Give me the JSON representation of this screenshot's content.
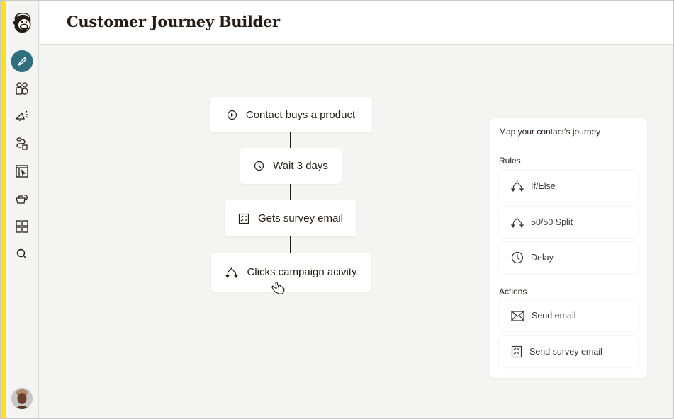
{
  "header": {
    "title": "Customer Journey Builder"
  },
  "sidebar": {
    "logo": "mailchimp-logo",
    "items": [
      {
        "name": "create",
        "icon": "pencil-icon",
        "active": true
      },
      {
        "name": "audience",
        "icon": "audience-icon"
      },
      {
        "name": "campaigns",
        "icon": "megaphone-icon"
      },
      {
        "name": "automations",
        "icon": "automation-icon"
      },
      {
        "name": "website",
        "icon": "website-icon"
      },
      {
        "name": "content",
        "icon": "content-icon"
      },
      {
        "name": "integrations",
        "icon": "grid-icon"
      },
      {
        "name": "search",
        "icon": "search-icon"
      }
    ],
    "avatar": "user-avatar"
  },
  "journey": {
    "nodes": [
      {
        "label": "Contact buys a product",
        "icon": "play-icon"
      },
      {
        "label": "Wait 3 days",
        "icon": "clock-icon"
      },
      {
        "label": "Gets survey email",
        "icon": "survey-icon"
      },
      {
        "label": "Clicks campaign acivity",
        "icon": "split-icon"
      }
    ]
  },
  "panel": {
    "title": "Map your contact’s journey",
    "rules_label": "Rules",
    "rules": [
      {
        "label": "If/Else",
        "icon": "split-icon"
      },
      {
        "label": "50/50 Split",
        "icon": "split-icon"
      },
      {
        "label": "Delay",
        "icon": "clock-icon"
      }
    ],
    "actions_label": "Actions",
    "actions": [
      {
        "label": "Send email",
        "icon": "envelope-icon"
      },
      {
        "label": "Send survey email",
        "icon": "survey-icon"
      }
    ]
  },
  "colors": {
    "accent": "#ffe01b",
    "active_nav": "#2f6f7e",
    "text": "#241c15"
  }
}
